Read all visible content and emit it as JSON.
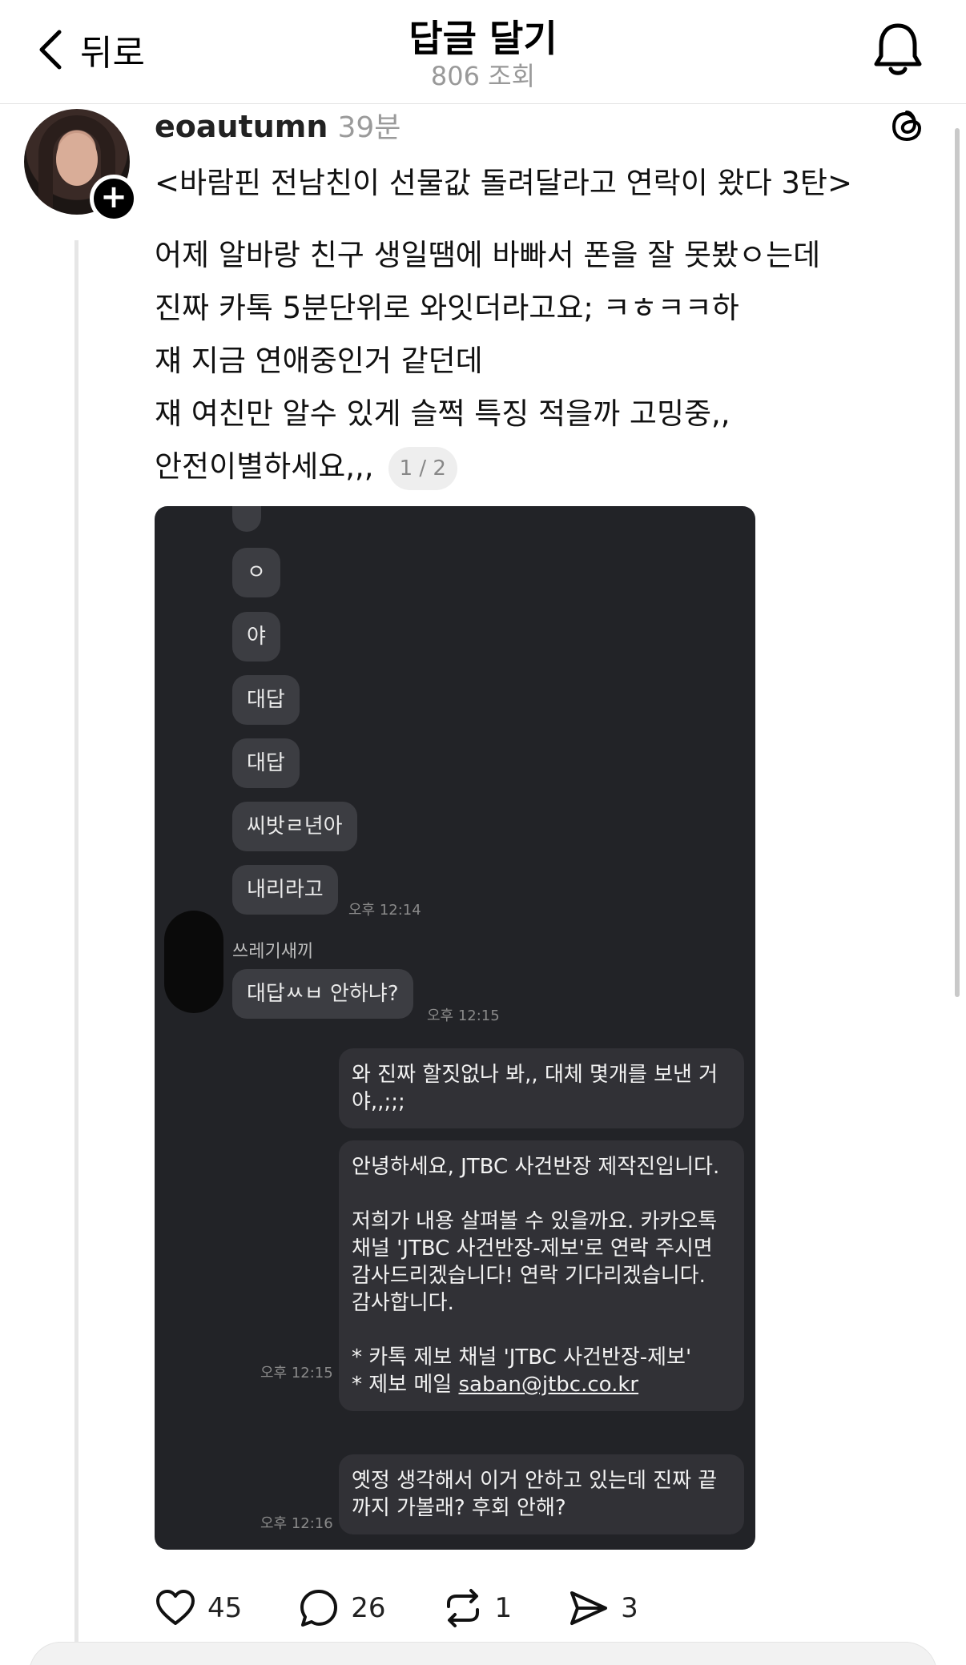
{
  "header": {
    "back_label": "뒤로",
    "title": "답글 달기",
    "views": "806 조회"
  },
  "post": {
    "author": "eoautumn",
    "time": "39분",
    "title": "<바람핀 전남친이 선물값 돌려달라고 연락이 왔다 3탄>",
    "body_lines": [
      "어제 알바랑 친구 생일땜에 바빠서 폰을 잘 못봤ㅇ는데",
      "진짜 카톡 5분단위로 와잇더라고요; ㅋㅎㅋㅋ하",
      "쟤 지금 연애중인거 같던데",
      "쟤 여친만 알수 있게 슬쩍 특징 적을까 고밍중,,",
      "안전이별하세요,,,"
    ],
    "page_indicator": "1 / 2"
  },
  "chat": {
    "incoming": [
      "ㅇ",
      "야",
      "대답",
      "대답",
      "씨밧ㄹ년아",
      "내리라고"
    ],
    "time_1": "오후 12:14",
    "sender_name": "쓰레기새끼",
    "incoming_last": "대답ㅆㅂ 안하냐?",
    "time_2": "오후 12:15",
    "outgoing_1": "와 진짜 할짓없나 봐,, 대체 몇개를 보낸 거야,,;;;",
    "outgoing_2_main": "안녕하세요, JTBC 사건반장 제작진입니다.\n\n저희가 내용 살펴볼 수 있을까요. 카카오톡 채널 'JTBC 사건반장-제보'로 연락 주시면 감사드리겠습니다! 연락 기다리겠습니다. 감사합니다.\n\n* 카톡 제보 채널 'JTBC 사건반장-제보'\n* 제보 메일 ",
    "outgoing_2_email": "saban@jtbc.co.kr",
    "time_3": "오후 12:15",
    "outgoing_3": "옛정 생각해서 이거 안하고 있는데 진짜 끝까지 가볼래? 후회 안해?",
    "time_4": "오후 12:16"
  },
  "actions": {
    "likes": "45",
    "comments": "26",
    "reposts": "1",
    "shares": "3"
  },
  "icons": {
    "back": "chevron-left-icon",
    "notification": "bell-icon",
    "app": "threads-icon",
    "like": "heart-icon",
    "comment": "comment-icon",
    "repost": "repost-icon",
    "share": "send-icon"
  }
}
